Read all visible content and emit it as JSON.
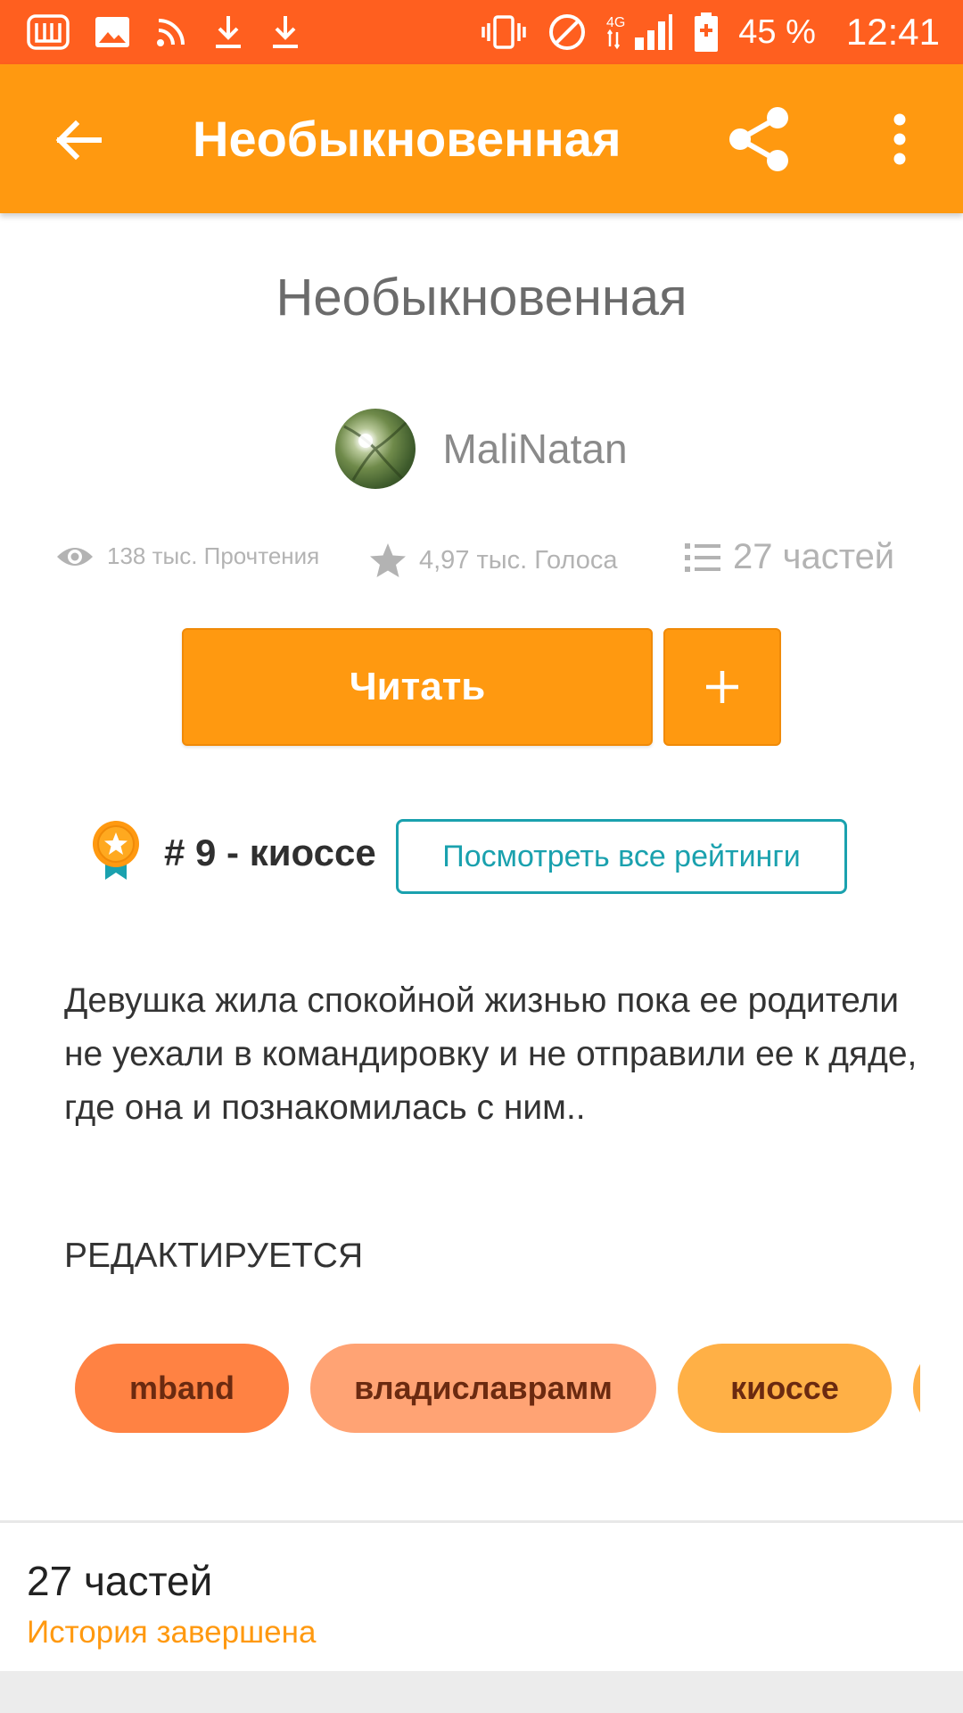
{
  "status_bar": {
    "battery": "45 %",
    "time": "12:41",
    "network": "4G",
    "icons": [
      "wattpad-icon",
      "image-icon",
      "rss-icon",
      "download-icon",
      "download-icon",
      "vibrate-icon",
      "no-disturb-icon",
      "signal-icon",
      "battery-icon"
    ]
  },
  "app_bar": {
    "title": "Необыкновенная",
    "back_icon": "arrow-left-icon",
    "share_icon": "share-icon",
    "more_icon": "more-vert-icon"
  },
  "story": {
    "title": "Необыкновенная",
    "author": "MaliNatan",
    "stats": {
      "reads": "138 тыс. Прочтения",
      "votes": "4,97 тыс. Голоса",
      "parts": "27 частей"
    },
    "read_button": "Читать",
    "add_button": "+",
    "rank": "# 9 - киоссе",
    "ratings_button": "Посмотреть все рейтинги",
    "description": "Девушка жила спокойной жизнью пока ее родители не уехали в командировку и не отправили ее к дяде, где она и познакомилась с ним..",
    "editing_note": "РЕДАКТИРУЕТСЯ",
    "tags": [
      "mband",
      "владиславрамм",
      "киоссе"
    ]
  },
  "parts_section": {
    "title": "27 частей",
    "status": "История завершена"
  },
  "colors": {
    "status_bar": "#FF5F1F",
    "app_bar": "#FF9910",
    "accent_teal": "#1AA1AE",
    "tag_1": "#FF8243",
    "tag_2": "#FFA374",
    "tag_3": "#FFB046"
  }
}
